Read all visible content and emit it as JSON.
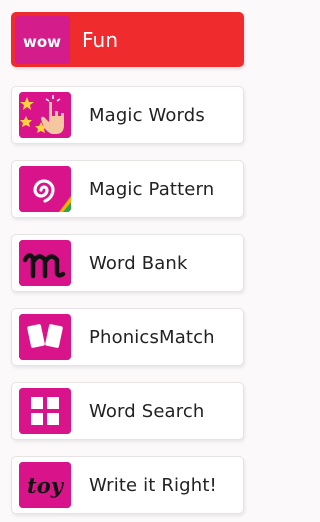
{
  "colors": {
    "active_bg": "#ef2b2d",
    "icon_bg": "#d9138a",
    "item_bg": "#ffffff",
    "text": "#222222",
    "active_text": "#ffffff"
  },
  "menu": {
    "items": [
      {
        "label": "Fun",
        "icon": "wow-logo-icon",
        "icon_text": "wow",
        "active": true
      },
      {
        "label": "Magic Words",
        "icon": "stars-finger-icon",
        "active": false
      },
      {
        "label": "Magic Pattern",
        "icon": "spiral-pattern-icon",
        "active": false
      },
      {
        "label": "Word Bank",
        "icon": "letter-m-icon",
        "active": false
      },
      {
        "label": "PhonicsMatch",
        "icon": "cards-icon",
        "active": false
      },
      {
        "label": "Word Search",
        "icon": "grid-icon",
        "active": false
      },
      {
        "label": "Write it Right!",
        "icon": "toy-word-icon",
        "icon_text": "toy",
        "active": false
      }
    ]
  }
}
